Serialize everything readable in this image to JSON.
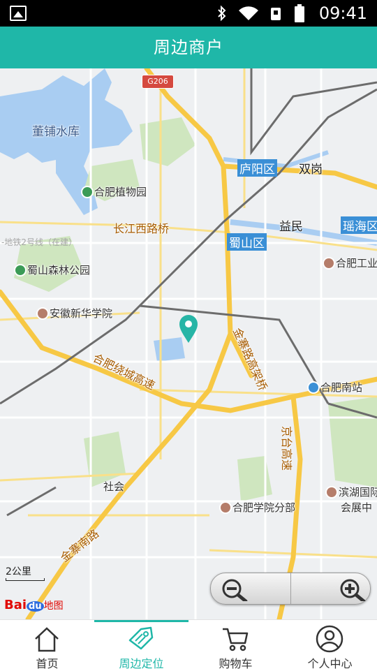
{
  "status_bar": {
    "time": "09:41"
  },
  "header": {
    "title": "周边商户"
  },
  "map": {
    "labels": {
      "dongpu": "董铺水库",
      "botanic": "合肥植物园",
      "changjiang": "长江西路桥",
      "metro": "-地铁2号线（在建）",
      "shushan_forest": "蜀山森林公园",
      "xinhua": "安徽新华学院",
      "raoc": "合肥绕城高速",
      "jinzhai_viaduct": "金寨路高架桥",
      "luyang": "庐阳区",
      "shuanggang": "双岗",
      "yimin": "益民",
      "yaohai": "瑶海区",
      "shushan_district": "蜀山区",
      "hefei_gongye": "合肥工业",
      "south_station": "合肥南站",
      "jingtai": "京台高速",
      "binhu": "滨湖国际",
      "huizhan": "会展中",
      "hefei_college": "合肥学院分部",
      "shehui": "社会",
      "jinzhai_south": "金寨南路",
      "shield": "G206"
    },
    "scale_label": "2公里",
    "logo": {
      "bai": "Bai",
      "du": "du",
      "ditu": "地图"
    },
    "colors": {
      "water": "#a9cdf2",
      "green": "#cfe6bf",
      "highway": "#f7c845",
      "road": "#ffffff",
      "rail": "#6c6c6c",
      "marker": "#27b5a6"
    }
  },
  "bottom_nav": {
    "tabs": [
      {
        "label": "首页",
        "icon": "home-icon",
        "active": false
      },
      {
        "label": "周边定位",
        "icon": "tag-icon",
        "active": true
      },
      {
        "label": "购物车",
        "icon": "cart-icon",
        "active": false
      },
      {
        "label": "个人中心",
        "icon": "user-icon",
        "active": false
      }
    ]
  }
}
